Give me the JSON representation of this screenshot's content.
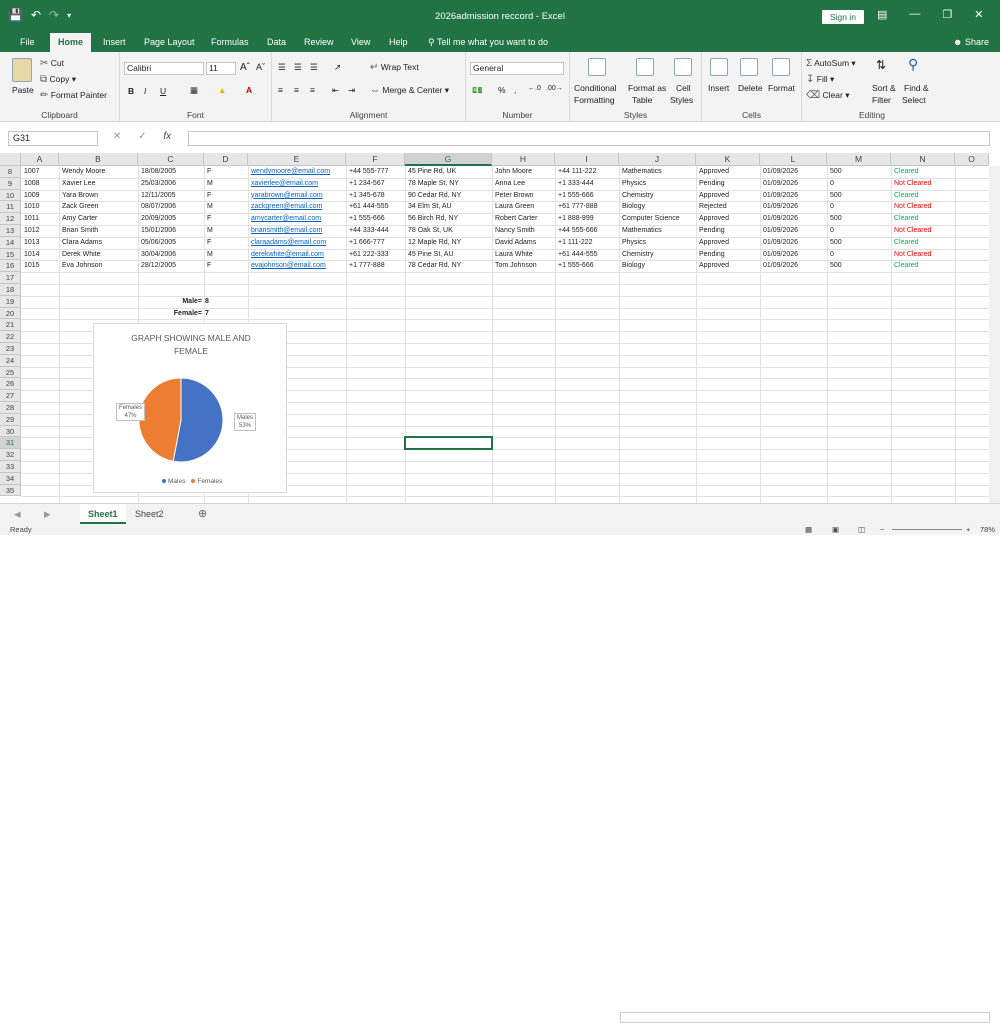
{
  "window": {
    "title": "2026admission reccord  -  Excel",
    "signin": "Sign in",
    "share": "Share"
  },
  "tabs": [
    "File",
    "Home",
    "Insert",
    "Page Layout",
    "Formulas",
    "Data",
    "Review",
    "View",
    "Help"
  ],
  "tellme": "Tell me what you want to do",
  "ribbon": {
    "clipboard": {
      "paste": "Paste",
      "cut": "Cut",
      "copy": "Copy",
      "format_painter": "Format Painter",
      "label": "Clipboard"
    },
    "font": {
      "name": "Calibri",
      "size": "11",
      "bold": "B",
      "italic": "I",
      "underline": "U",
      "label": "Font"
    },
    "alignment": {
      "wrap": "Wrap Text",
      "merge": "Merge & Center",
      "label": "Alignment"
    },
    "number": {
      "format": "General",
      "percent": "%",
      "comma": ",",
      "label": "Number"
    },
    "styles": {
      "conditional": "Conditional",
      "conditional2": "Formatting",
      "format_as": "Format as",
      "format_as2": "Table",
      "cell": "Cell",
      "cell2": "Styles",
      "label": "Styles"
    },
    "cells": {
      "insert": "Insert",
      "delete": "Delete",
      "format": "Format",
      "label": "Cells"
    },
    "editing": {
      "autosum": "AutoSum",
      "fill": "Fill",
      "clear": "Clear",
      "sort": "Sort &",
      "sort2": "Filter",
      "find": "Find &",
      "find2": "Select",
      "label": "Editing"
    }
  },
  "formula_bar": {
    "namebox": "G31",
    "fx": "fx",
    "value": ""
  },
  "columns": [
    "A",
    "B",
    "C",
    "D",
    "E",
    "F",
    "G",
    "H",
    "I",
    "J",
    "K",
    "L",
    "M",
    "N",
    "O"
  ],
  "rows": [
    "8",
    "9",
    "10",
    "11",
    "12",
    "13",
    "14",
    "15",
    "16",
    "17",
    "18",
    "19",
    "20",
    "21",
    "22",
    "23",
    "24",
    "25",
    "26",
    "27",
    "28",
    "29",
    "30",
    "31",
    "32",
    "33",
    "34",
    "35"
  ],
  "table": [
    [
      "1007",
      "Wendy Moore",
      "18/08/2005",
      "F",
      "wendymoore@email.com",
      "+44 555-777",
      "45 Pine Rd, UK",
      "John Moore",
      "+44 111-222",
      "Mathematics",
      "Approved",
      "01/09/2026",
      "500",
      "Cleared"
    ],
    [
      "1008",
      "Xavier Lee",
      "25/03/2006",
      "M",
      "xavierlee@email.com",
      "+1 234-567",
      "78 Maple St, NY",
      "Anna Lee",
      "+1 333-444",
      "Physics",
      "Pending",
      "01/09/2026",
      "0",
      "Not Cleared"
    ],
    [
      "1009",
      "Yara Brown",
      "12/11/2005",
      "F",
      "yarabrown@email.com",
      "+1 345-678",
      "90 Cedar Rd, NY",
      "Peter Brown",
      "+1 555-666",
      "Chemistry",
      "Approved",
      "01/09/2026",
      "500",
      "Cleared"
    ],
    [
      "1010",
      "Zack Green",
      "08/07/2006",
      "M",
      "zackgreen@email.com",
      "+61 444-555",
      "34 Elm St, AU",
      "Laura Green",
      "+61 777-888",
      "Biology",
      "Rejected",
      "01/09/2026",
      "0",
      "Not Cleared"
    ],
    [
      "1011",
      "Amy Carter",
      "20/09/2005",
      "F",
      "amycarter@email.com",
      "+1 555-666",
      "56 Birch Rd, NY",
      "Robert Carter",
      "+1 888-999",
      "Computer Science",
      "Approved",
      "01/09/2026",
      "500",
      "Cleared"
    ],
    [
      "1012",
      "Brian Smith",
      "15/01/2006",
      "M",
      "briansmith@email.com",
      "+44 333-444",
      "78 Oak St, UK",
      "Nancy Smith",
      "+44 555-666",
      "Mathematics",
      "Pending",
      "01/09/2026",
      "0",
      "Not Cleared"
    ],
    [
      "1013",
      "Clara Adams",
      "05/06/2005",
      "F",
      "claraadams@email.com",
      "+1 666-777",
      "12 Maple Rd, NY",
      "David Adams",
      "+1 111-222",
      "Physics",
      "Approved",
      "01/09/2026",
      "500",
      "Cleared"
    ],
    [
      "1014",
      "Derek White",
      "30/04/2006",
      "M",
      "derekwhite@email.com",
      "+61 222-333",
      "45 Pine St, AU",
      "Laura White",
      "+61 444-555",
      "Chemistry",
      "Pending",
      "01/09/2026",
      "0",
      "Not Cleared"
    ],
    [
      "1015",
      "Eva Johnson",
      "28/12/2005",
      "F",
      "evajohnson@email.com",
      "+1 777-888",
      "78 Cedar Rd, NY",
      "Tom Johnson",
      "+1 555-666",
      "Biology",
      "Approved",
      "01/09/2026",
      "500",
      "Cleared"
    ]
  ],
  "summary": {
    "male_label": "Male=",
    "male_value": "8",
    "female_label": "Female=",
    "female_value": "7"
  },
  "chart_data": {
    "type": "pie",
    "title": "GRAPH SHOWING MALE AND FEMALE",
    "title_line1": "GRAPH SHOWING MALE AND",
    "title_line2": "FEMALE",
    "categories": [
      "Males",
      "Females"
    ],
    "values": [
      53,
      47
    ],
    "labels": [
      {
        "name": "Males",
        "pct": "53%"
      },
      {
        "name": "Females",
        "pct": "47%"
      }
    ],
    "colors": {
      "Males": "#4472c4",
      "Females": "#ed7d31"
    },
    "legend_position": "bottom"
  },
  "sheets": [
    "Sheet1",
    "Sheet2"
  ],
  "status": {
    "ready": "Ready",
    "zoom": "78%"
  }
}
